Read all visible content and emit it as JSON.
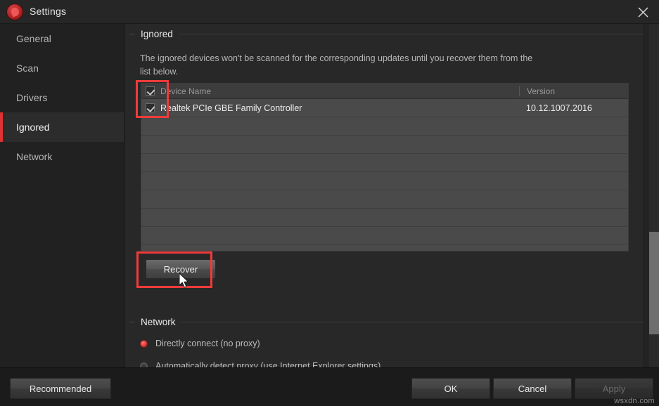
{
  "window": {
    "title": "Settings",
    "logo_icon": "app-logo-red-circle",
    "close_icon": "close-icon"
  },
  "sidebar": {
    "items": [
      {
        "label": "General",
        "active": false
      },
      {
        "label": "Scan",
        "active": false
      },
      {
        "label": "Drivers",
        "active": false
      },
      {
        "label": "Ignored",
        "active": true
      },
      {
        "label": "Network",
        "active": false
      }
    ]
  },
  "main": {
    "ignored_section": {
      "legend": "Ignored",
      "description": "The ignored devices won't be scanned for the corresponding updates until you recover them from the list below.",
      "table": {
        "select_all_checked": true,
        "columns": [
          "Device Name",
          "Version"
        ],
        "rows": [
          {
            "checked": true,
            "device_name": "Realtek PCIe GBE Family Controller",
            "version": "10.12.1007.2016"
          }
        ],
        "empty_row_count": 7
      },
      "recover_button": "Recover"
    },
    "network_section": {
      "legend": "Network",
      "options": [
        {
          "label": "Directly connect (no proxy)",
          "selected": true
        },
        {
          "label": "Automatically detect proxy (use Internet Explorer settings)",
          "selected": false
        }
      ]
    }
  },
  "footer": {
    "recommended_label": "Recommended",
    "ok_label": "OK",
    "cancel_label": "Cancel",
    "apply_label": "Apply",
    "apply_disabled": true
  },
  "watermark": "wsxdn.com",
  "colors": {
    "accent_red": "#e03232",
    "annotation_red": "#ef3b3b",
    "window_bg": "#232323",
    "panel_bg": "#282828",
    "table_bg": "#4a4a4a"
  }
}
